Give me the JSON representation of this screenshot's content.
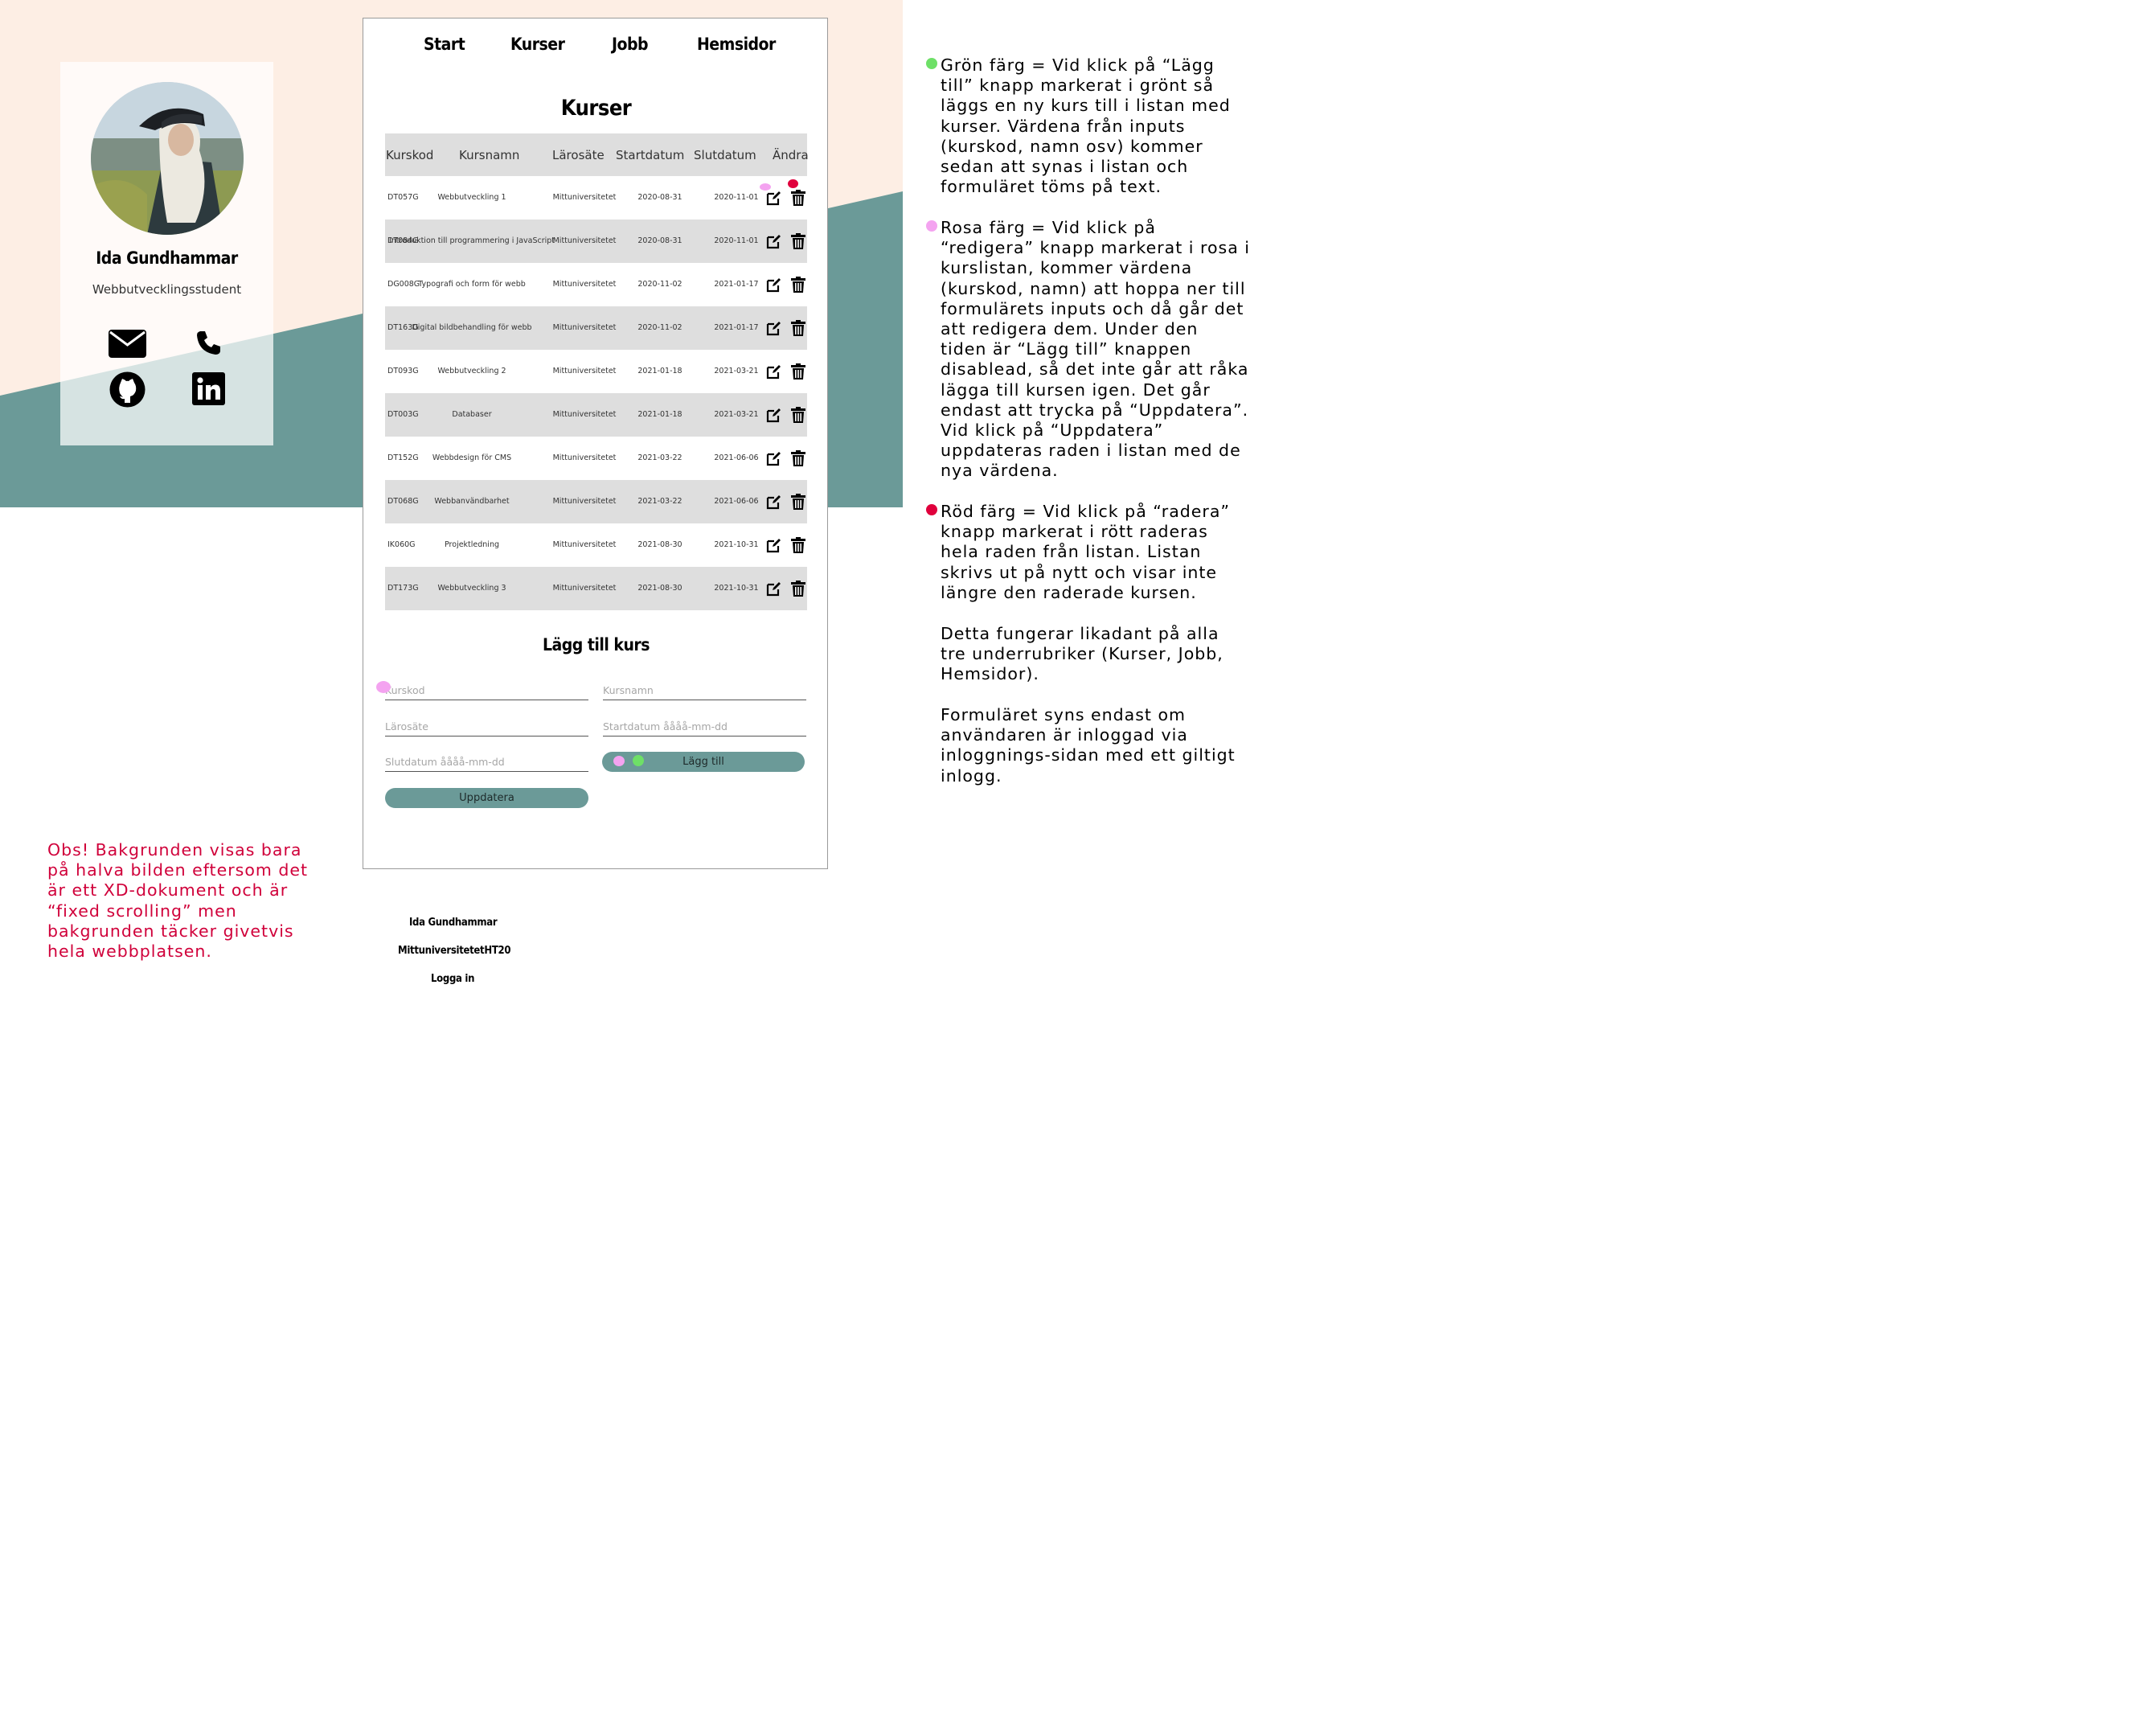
{
  "colors": {
    "peach": "#fdeee4",
    "teal": "#6b9a98",
    "pink_marker": "#f4a3f0",
    "green_marker": "#6ee067",
    "red_marker": "#e0003c",
    "row_shade": "#dedede"
  },
  "profile": {
    "name": "Ida Gundhammar",
    "title": "Webbutvecklingsstudent",
    "icons": [
      "email-icon",
      "phone-icon",
      "github-icon",
      "linkedin-icon"
    ]
  },
  "nav": {
    "items": [
      "Start",
      "Kurser",
      "Jobb",
      "Hemsidor"
    ]
  },
  "page_title": "Kurser",
  "table": {
    "headers": [
      "Kurskod",
      "Kursnamn",
      "Lärosäte",
      "Startdatum",
      "Slutdatum",
      "Ändra"
    ],
    "rows": [
      [
        "DT057G",
        "Webbutveckling 1",
        "Mittuniversitetet",
        "2020-08-31",
        "2020-11-01"
      ],
      [
        "DT084G",
        "Introduktion till programmering i JavaScript",
        "Mittuniversitetet",
        "2020-08-31",
        "2020-11-01"
      ],
      [
        "DG008G",
        "Typografi och form för webb",
        "Mittuniversitetet",
        "2020-11-02",
        "2021-01-17"
      ],
      [
        "DT163G",
        "Digital bildbehandling för webb",
        "Mittuniversitetet",
        "2020-11-02",
        "2021-01-17"
      ],
      [
        "DT093G",
        "Webbutveckling 2",
        "Mittuniversitetet",
        "2021-01-18",
        "2021-03-21"
      ],
      [
        "DT003G",
        "Databaser",
        "Mittuniversitetet",
        "2021-01-18",
        "2021-03-21"
      ],
      [
        "DT152G",
        "Webbdesign för CMS",
        "Mittuniversitetet",
        "2021-03-22",
        "2021-06-06"
      ],
      [
        "DT068G",
        "Webbanvändbarhet",
        "Mittuniversitetet",
        "2021-03-22",
        "2021-06-06"
      ],
      [
        "IK060G",
        "Projektledning",
        "Mittuniversitetet",
        "2021-08-30",
        "2021-10-31"
      ],
      [
        "DT173G",
        "Webbutveckling 3",
        "Mittuniversitetet",
        "2021-08-30",
        "2021-10-31"
      ]
    ]
  },
  "form": {
    "title": "Lägg till kurs",
    "placeholders": {
      "kurskod": "Kurskod",
      "kursnamn": "Kursnamn",
      "larosate": "Lärosäte",
      "startdatum": "Startdatum åååå-mm-dd",
      "slutdatum": "Slutdatum åååå-mm-dd"
    },
    "add_button": "Lägg till",
    "update_button": "Uppdatera"
  },
  "footer": {
    "name": "Ida Gundhammar",
    "school": "MittuniversitetetHT20",
    "login": "Logga in"
  },
  "notes": {
    "green": "Grön färg = Vid klick på “Lägg till” knapp markerat i grönt så läggs en ny kurs till i listan med kurser. Värdena från inputs (kurskod, namn osv) kommer sedan att synas i listan och formuläret töms på text.",
    "pink": "Rosa färg = Vid klick på “redigera” knapp markerat i rosa i kurslistan, kommer värdena (kurskod, namn) att hoppa ner till formulärets inputs och då går det att redigera dem. Under den tiden är “Lägg till” knappen disablead, så det inte går att råka lägga till kursen igen. Det går endast att trycka på “Uppdatera”. Vid klick på “Uppdatera” uppdateras raden i listan med de nya värdena.",
    "red": "Röd färg = Vid klick på “radera” knapp markerat i rött raderas hela raden från listan. Listan skrivs ut på nytt och visar inte längre den raderade kursen.",
    "same": "Detta fungerar likadant på alla tre underrubriker (Kurser, Jobb, Hemsidor).",
    "login_only": "Formuläret syns endast om användaren är inloggad via inloggnings-sidan med ett giltigt inlogg.",
    "obs": "Obs! Bakgrunden visas bara på halva bilden eftersom det är ett XD-dokument och är “fixed scrolling” men bakgrunden täcker givetvis hela webbplatsen."
  }
}
